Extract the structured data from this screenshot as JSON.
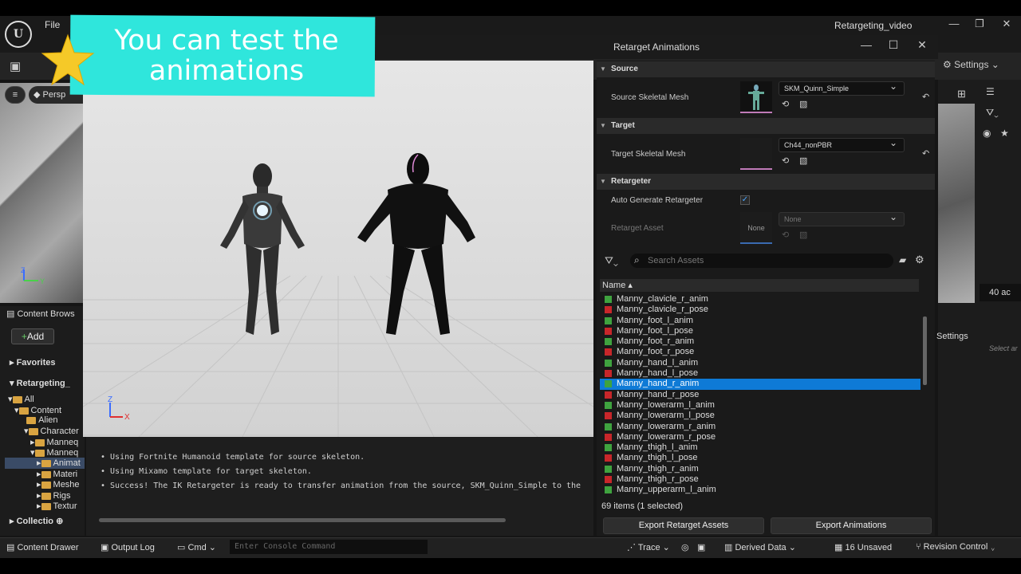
{
  "app": {
    "menu_file": "File",
    "project_title": "Retargeting_video",
    "settings_label": "Settings"
  },
  "banner": {
    "line1": "You can test the",
    "line2": "animations"
  },
  "viewport_left": {
    "perspective_label": "Persp"
  },
  "content_browser": {
    "title": "Content Brows",
    "add_label": "Add",
    "favorites": "Favorites",
    "root": "Retargeting_",
    "tree": [
      "All",
      "Content",
      "Alien",
      "Character",
      "Manneq",
      "Manneq",
      "Animat",
      "Materi",
      "Meshe",
      "Rigs",
      "Textur"
    ],
    "collections": "Collectio"
  },
  "dialog": {
    "title": "Retarget Animations",
    "source_section": "Source",
    "source_mesh_label": "Source Skeletal Mesh",
    "source_mesh_value": "SKM_Quinn_Simple",
    "target_section": "Target",
    "target_mesh_label": "Target Skeletal Mesh",
    "target_mesh_value": "Ch44_nonPBR",
    "retargeter_section": "Retargeter",
    "auto_generate_label": "Auto Generate Retargeter",
    "auto_generate_checked": true,
    "retarget_asset_label": "Retarget Asset",
    "retarget_asset_thumb": "None",
    "retarget_asset_value": "None",
    "search_placeholder": "Search Assets",
    "column_name": "Name",
    "items_count": "69 items (1 selected)",
    "export_assets_btn": "Export Retarget Assets",
    "export_anims_btn": "Export Animations"
  },
  "asset_list": [
    {
      "name": "Manny_clavicle_r_anim",
      "type": "anim"
    },
    {
      "name": "Manny_clavicle_r_pose",
      "type": "pose"
    },
    {
      "name": "Manny_foot_l_anim",
      "type": "anim"
    },
    {
      "name": "Manny_foot_l_pose",
      "type": "pose"
    },
    {
      "name": "Manny_foot_r_anim",
      "type": "anim"
    },
    {
      "name": "Manny_foot_r_pose",
      "type": "pose"
    },
    {
      "name": "Manny_hand_l_anim",
      "type": "anim"
    },
    {
      "name": "Manny_hand_l_pose",
      "type": "pose"
    },
    {
      "name": "Manny_hand_r_anim",
      "type": "anim",
      "selected": true
    },
    {
      "name": "Manny_hand_r_pose",
      "type": "pose"
    },
    {
      "name": "Manny_lowerarm_l_anim",
      "type": "anim"
    },
    {
      "name": "Manny_lowerarm_l_pose",
      "type": "pose"
    },
    {
      "name": "Manny_lowerarm_r_anim",
      "type": "anim"
    },
    {
      "name": "Manny_lowerarm_r_pose",
      "type": "pose"
    },
    {
      "name": "Manny_thigh_l_anim",
      "type": "anim"
    },
    {
      "name": "Manny_thigh_l_pose",
      "type": "pose"
    },
    {
      "name": "Manny_thigh_r_anim",
      "type": "anim"
    },
    {
      "name": "Manny_thigh_r_pose",
      "type": "pose"
    },
    {
      "name": "Manny_upperarm_l_anim",
      "type": "anim"
    }
  ],
  "colors": {
    "anim": "#3fa33f",
    "pose": "#c8262a",
    "selection": "#0e7ad6",
    "banner": "#2fe6dc"
  },
  "log": [
    "• Using Fortnite Humanoid template for source skeleton.",
    "• Using Mixamo template for target skeleton.",
    "• Success! The IK Retargeter is ready to transfer animation from the source, SKM_Quinn_Simple to the"
  ],
  "axis": {
    "z": "Z",
    "x": "X",
    "y": "Y"
  },
  "right_strip": {
    "zoom": "40 ac",
    "settings": "Settings",
    "select": "Select ar"
  },
  "statusbar": {
    "content_drawer": "Content Drawer",
    "output_log": "Output Log",
    "cmd": "Cmd",
    "console_placeholder": "Enter Console Command",
    "trace": "Trace",
    "derived_data": "Derived Data",
    "unsaved": "16 Unsaved",
    "revision_control": "Revision Control"
  }
}
